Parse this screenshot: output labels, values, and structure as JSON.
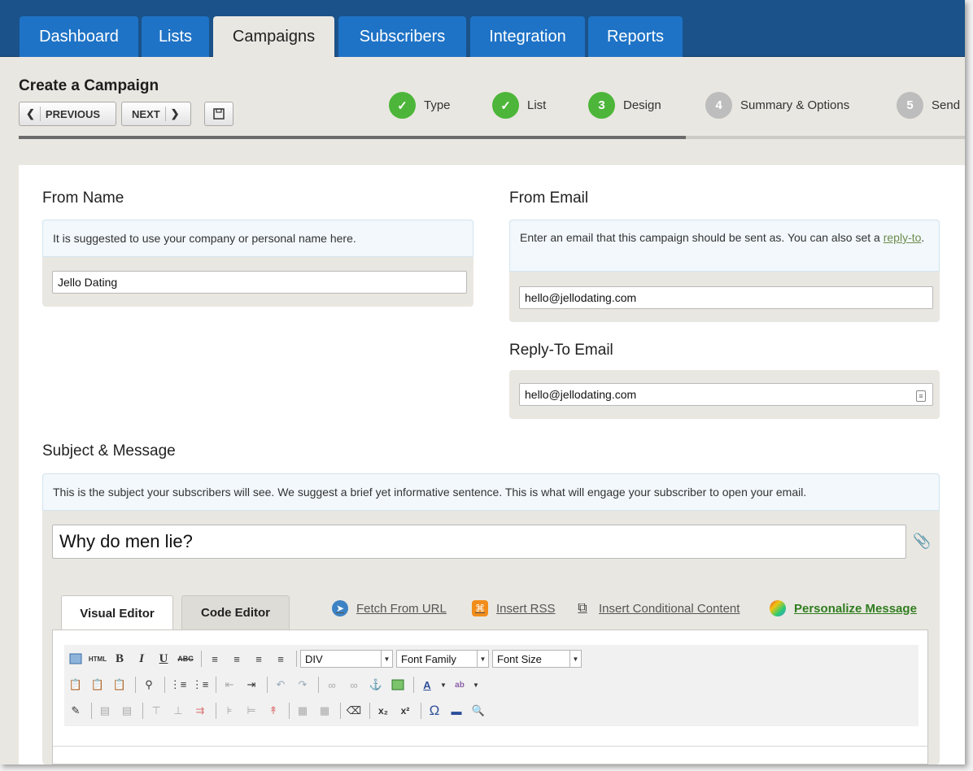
{
  "nav": {
    "tabs": [
      {
        "label": "Dashboard"
      },
      {
        "label": "Lists"
      },
      {
        "label": "Campaigns"
      },
      {
        "label": "Subscribers"
      },
      {
        "label": "Integration"
      },
      {
        "label": "Reports"
      }
    ],
    "active_tab": "Campaigns"
  },
  "header": {
    "title": "Create a Campaign",
    "previous_label": "PREVIOUS",
    "next_label": "NEXT"
  },
  "steps": [
    {
      "marker": "✓",
      "label": "Type",
      "state": "done"
    },
    {
      "marker": "✓",
      "label": "List",
      "state": "done"
    },
    {
      "marker": "3",
      "label": "Design",
      "state": "current"
    },
    {
      "marker": "4",
      "label": "Summary & Options",
      "state": "todo"
    },
    {
      "marker": "5",
      "label": "Send",
      "state": "todo"
    }
  ],
  "from_name": {
    "label": "From Name",
    "hint": "It is suggested to use your company or personal name here.",
    "value": "Jello Dating"
  },
  "from_email": {
    "label": "From Email",
    "hint_before": "Enter an email that this campaign should be sent as. You can also set a ",
    "hint_link": "reply-to",
    "hint_after": ".",
    "value": "hello@jellodating.com"
  },
  "reply_to": {
    "label": "Reply-To Email",
    "value": "hello@jellodating.com"
  },
  "subject": {
    "label": "Subject & Message",
    "hint": "This is the subject your subscribers will see. We suggest a brief yet informative sentence. This is what will engage your subscriber to open your email.",
    "value": "Why do men lie?"
  },
  "editor": {
    "tabs": [
      {
        "label": "Visual Editor"
      },
      {
        "label": "Code Editor"
      }
    ],
    "links": {
      "fetch": "Fetch From URL",
      "rss": "Insert RSS",
      "conditional": "Insert Conditional Content",
      "personalize": "Personalize Message"
    },
    "format_select": "DIV",
    "font_family_select": "Font Family",
    "font_size_select": "Font Size"
  },
  "colors": {
    "nav_bg": "#1a5289",
    "tab_bg": "#1e73c6",
    "step_done": "#4db63a",
    "step_todo": "#bdbdbd",
    "link_green": "#2f7d1f"
  }
}
